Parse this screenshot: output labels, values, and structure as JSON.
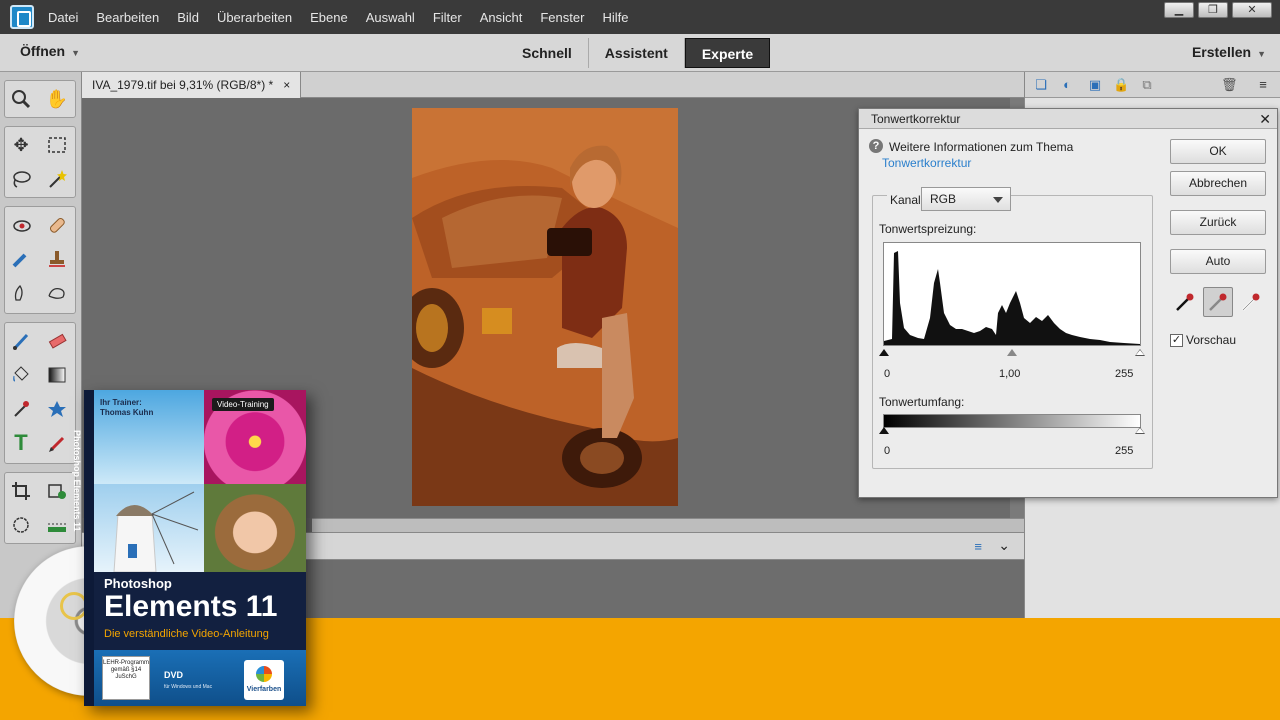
{
  "menubar": {
    "items": [
      "Datei",
      "Bearbeiten",
      "Bild",
      "Überarbeiten",
      "Ebene",
      "Auswahl",
      "Filter",
      "Ansicht",
      "Fenster",
      "Hilfe"
    ]
  },
  "modebar": {
    "open_label": "Öffnen",
    "tabs": [
      {
        "label": "Schnell",
        "active": false
      },
      {
        "label": "Assistent",
        "active": false
      },
      {
        "label": "Experte",
        "active": true
      }
    ],
    "create_label": "Erstellen"
  },
  "document": {
    "tab_title": "IVA_1979.tif bei 9,31% (RGB/8*) *",
    "close": "×"
  },
  "dialog": {
    "title": "Tonwertkorrektur",
    "help_text": "Weitere Informationen zum Thema",
    "help_link": "Tonwertkorrektur",
    "channel_label": "Kanal:",
    "channel_value": "RGB",
    "input_label": "Tonwertspreizung:",
    "input_values": {
      "black": "0",
      "mid": "1,00",
      "white": "255"
    },
    "output_label": "Tonwertumfang:",
    "output_values": {
      "black": "0",
      "white": "255"
    },
    "buttons": {
      "ok": "OK",
      "cancel": "Abbrechen",
      "reset": "Zurück",
      "auto": "Auto"
    },
    "preview_label": "Vorschau",
    "preview_checked": true
  },
  "promo": {
    "trainer_line1": "Ihr Trainer:",
    "trainer_line2": "Thomas Kuhn",
    "video_badge": "Video-Training",
    "product_small": "Photoshop",
    "product_big": "Elements 11",
    "product_sub": "Die verständliche Video-Anleitung",
    "lehr_badge": "LEHR-Programm gemäß §14 JuSchG",
    "dvd": "DVD",
    "dvd_small": "für Windows und Mac",
    "publisher": "Vierfarben",
    "spine": "Photoshop Elements 11",
    "accent": "#f4a500"
  }
}
